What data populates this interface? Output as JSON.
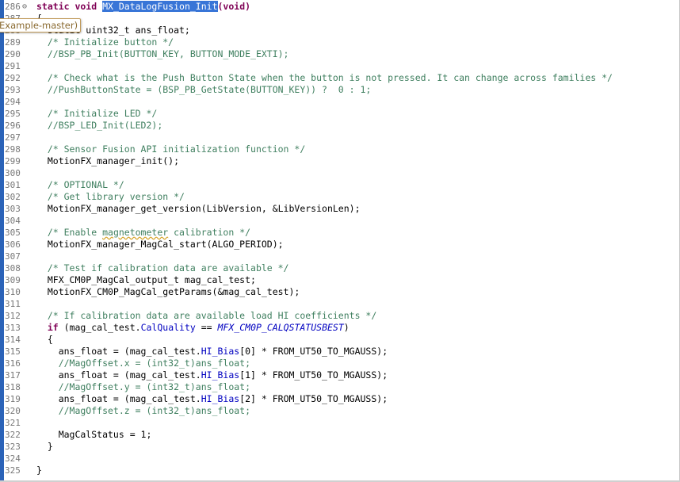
{
  "tooltip": {
    "text": "Example-master)"
  },
  "lines": [
    {
      "num": "286",
      "fold": "⊖",
      "segs": [
        {
          "t": "static void ",
          "c": "kw"
        },
        {
          "t": "MX_DataLogFusion_Init",
          "c": "sel"
        },
        {
          "t": "(void)",
          "c": "kw"
        }
      ]
    },
    {
      "num": "287",
      "segs": [
        {
          "t": "{",
          "c": ""
        }
      ]
    },
    {
      "num": "288",
      "segs": [
        {
          "t": "  static uint32_t ans_float;",
          "c": ""
        }
      ]
    },
    {
      "num": "289",
      "segs": [
        {
          "t": "  /* Initialize button */",
          "c": "cm"
        }
      ]
    },
    {
      "num": "290",
      "segs": [
        {
          "t": "  //BSP_PB_Init(BUTTON_KEY, BUTTON_MODE_EXTI);",
          "c": "cm"
        }
      ]
    },
    {
      "num": "291",
      "segs": []
    },
    {
      "num": "292",
      "segs": [
        {
          "t": "  /* Check what is the Push Button State when the button is not pressed. It can change across families */",
          "c": "cm"
        }
      ]
    },
    {
      "num": "293",
      "segs": [
        {
          "t": "  //PushButtonState = (BSP_PB_GetState(BUTTON_KEY)) ?  0 : 1;",
          "c": "cm"
        }
      ]
    },
    {
      "num": "294",
      "segs": []
    },
    {
      "num": "295",
      "segs": [
        {
          "t": "  /* Initialize LED */",
          "c": "cm"
        }
      ]
    },
    {
      "num": "296",
      "segs": [
        {
          "t": "  //BSP_LED_Init(LED2);",
          "c": "cm"
        }
      ]
    },
    {
      "num": "297",
      "segs": []
    },
    {
      "num": "298",
      "segs": [
        {
          "t": "  /* Sensor Fusion API initialization function */",
          "c": "cm"
        }
      ]
    },
    {
      "num": "299",
      "segs": [
        {
          "t": "  MotionFX_manager_init();",
          "c": ""
        }
      ]
    },
    {
      "num": "300",
      "segs": []
    },
    {
      "num": "301",
      "segs": [
        {
          "t": "  /* OPTIONAL */",
          "c": "cm"
        }
      ]
    },
    {
      "num": "302",
      "segs": [
        {
          "t": "  /* Get library version */",
          "c": "cm"
        }
      ]
    },
    {
      "num": "303",
      "segs": [
        {
          "t": "  MotionFX_manager_get_version(LibVersion, &LibVersionLen);",
          "c": ""
        }
      ]
    },
    {
      "num": "304",
      "segs": []
    },
    {
      "num": "305",
      "segs": [
        {
          "t": "  /* Enable ",
          "c": "cm"
        },
        {
          "t": "magnetometer",
          "c": "cm err"
        },
        {
          "t": " calibration */",
          "c": "cm"
        }
      ]
    },
    {
      "num": "306",
      "segs": [
        {
          "t": "  MotionFX_manager_MagCal_start(ALGO_PERIOD);",
          "c": ""
        }
      ]
    },
    {
      "num": "307",
      "segs": []
    },
    {
      "num": "308",
      "segs": [
        {
          "t": "  /* Test if calibration data are available */",
          "c": "cm"
        }
      ]
    },
    {
      "num": "309",
      "segs": [
        {
          "t": "  MFX_CM0P_MagCal_output_t mag_cal_test;",
          "c": ""
        }
      ]
    },
    {
      "num": "310",
      "segs": [
        {
          "t": "  MotionFX_CM0P_MagCal_getParams(&mag_cal_test);",
          "c": ""
        }
      ]
    },
    {
      "num": "311",
      "segs": []
    },
    {
      "num": "312",
      "segs": [
        {
          "t": "  /* If calibration data are available load HI coefficients */",
          "c": "cm"
        }
      ]
    },
    {
      "num": "313",
      "segs": [
        {
          "t": "  ",
          "c": ""
        },
        {
          "t": "if",
          "c": "kw"
        },
        {
          "t": " (mag_cal_test.",
          "c": ""
        },
        {
          "t": "CalQuality",
          "c": "fld"
        },
        {
          "t": " == ",
          "c": ""
        },
        {
          "t": "MFX_CM0P_CALQSTATUSBEST",
          "c": "macro"
        },
        {
          "t": ")",
          "c": ""
        }
      ]
    },
    {
      "num": "314",
      "segs": [
        {
          "t": "  {",
          "c": ""
        }
      ]
    },
    {
      "num": "315",
      "segs": [
        {
          "t": "    ans_float = (mag_cal_test.",
          "c": ""
        },
        {
          "t": "HI_Bias",
          "c": "fld"
        },
        {
          "t": "[0] * FROM_UT50_TO_MGAUSS);",
          "c": ""
        }
      ]
    },
    {
      "num": "316",
      "segs": [
        {
          "t": "    //MagOffset.x = (int32_t)ans_float;",
          "c": "cm"
        }
      ]
    },
    {
      "num": "317",
      "segs": [
        {
          "t": "    ans_float = (mag_cal_test.",
          "c": ""
        },
        {
          "t": "HI_Bias",
          "c": "fld"
        },
        {
          "t": "[1] * FROM_UT50_TO_MGAUSS);",
          "c": ""
        }
      ]
    },
    {
      "num": "318",
      "segs": [
        {
          "t": "    //MagOffset.y = (int32_t)ans_float;",
          "c": "cm"
        }
      ]
    },
    {
      "num": "319",
      "segs": [
        {
          "t": "    ans_float = (mag_cal_test.",
          "c": ""
        },
        {
          "t": "HI_Bias",
          "c": "fld"
        },
        {
          "t": "[2] * FROM_UT50_TO_MGAUSS);",
          "c": ""
        }
      ]
    },
    {
      "num": "320",
      "segs": [
        {
          "t": "    //MagOffset.z = (int32_t)ans_float;",
          "c": "cm"
        }
      ]
    },
    {
      "num": "321",
      "segs": []
    },
    {
      "num": "322",
      "segs": [
        {
          "t": "    MagCalStatus = 1;",
          "c": ""
        }
      ]
    },
    {
      "num": "323",
      "segs": [
        {
          "t": "  }",
          "c": ""
        }
      ]
    },
    {
      "num": "324",
      "segs": []
    },
    {
      "num": "325",
      "segs": [
        {
          "t": "}",
          "c": ""
        }
      ]
    }
  ]
}
